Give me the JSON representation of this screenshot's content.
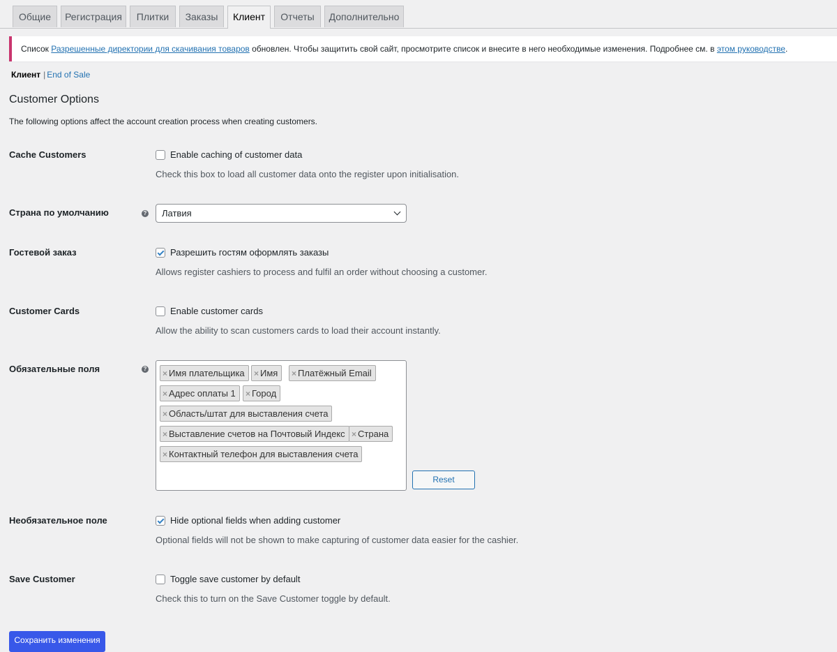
{
  "tabs": [
    {
      "label": "Общие"
    },
    {
      "label": "Регистрация"
    },
    {
      "label": "Плитки"
    },
    {
      "label": "Заказы"
    },
    {
      "label": "Клиент"
    },
    {
      "label": "Отчеты"
    },
    {
      "label": "Дополнительно"
    }
  ],
  "active_tab": "Клиент",
  "notice": {
    "prefix": "Список ",
    "link1": "Разрешенные директории для скачивания товаров",
    "middle": " обновлен. Чтобы защитить свой сайт, просмотрите список и внесите в него необходимые изменения. Подробнее см. в ",
    "link2": "этом руководстве",
    "suffix": "."
  },
  "subnav": {
    "current": "Клиент",
    "separator": "|",
    "link": "End of Sale"
  },
  "section": {
    "title": "Customer Options",
    "description": "The following options affect the account creation process when creating customers."
  },
  "settings": {
    "cache": {
      "label": "Cache Customers",
      "checkbox_label": "Enable caching of customer data",
      "checked": false,
      "description": "Check this box to load all customer data onto the register upon initialisation."
    },
    "country": {
      "label": "Страна по умолчанию",
      "value": "Латвия"
    },
    "guest": {
      "label": "Гостевой заказ",
      "checkbox_label": "Разрешить гостям оформлять заказы",
      "checked": true,
      "description": "Allows register cashiers to process and fulfil an order without choosing a customer."
    },
    "cards": {
      "label": "Customer Cards",
      "checkbox_label": "Enable customer cards",
      "checked": false,
      "description": "Allow the ability to scan customers cards to load their account instantly."
    },
    "required": {
      "label": "Обязательные поля",
      "tags": [
        "Имя плательщика",
        "Имя",
        "Платёжный Email",
        "Адрес оплаты 1",
        "Город",
        "Область/штат для выставления счета",
        "Выставление счетов на Почтовый Индекс",
        "Страна",
        "Контактный телефон для выставления счета"
      ],
      "reset_label": "Reset"
    },
    "optional": {
      "label": "Необязательное поле",
      "checkbox_label": "Hide optional fields when adding customer",
      "checked": true,
      "description": "Optional fields will not be shown to make capturing of customer data easier for the cashier."
    },
    "save_customer": {
      "label": "Save Customer",
      "checkbox_label": "Toggle save customer by default",
      "checked": false,
      "description": "Check this to turn on the Save Customer toggle by default."
    }
  },
  "save_button": "Сохранить изменения",
  "help_icon": "?",
  "tag_remove": "×"
}
